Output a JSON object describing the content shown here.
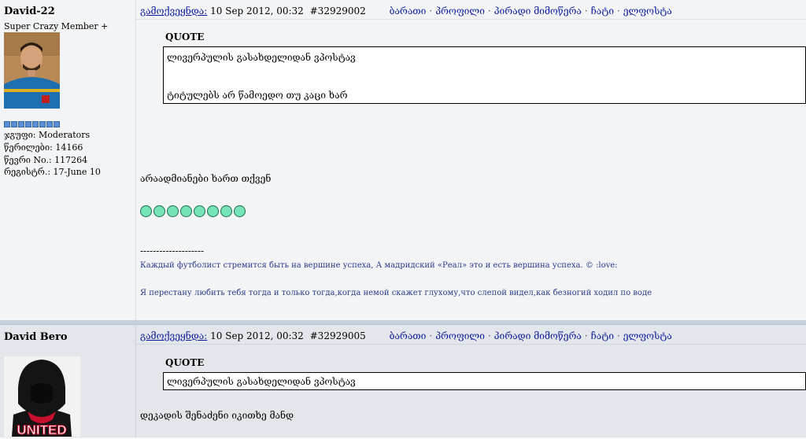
{
  "posts": [
    {
      "username": "David-22",
      "rank": "Super Crazy Member +",
      "group": "ჯგუფი: Moderators",
      "posts_count": "წერილები: 14166",
      "member_no": "წევრი No.: 117264",
      "registered": "რეგისტრ.: 17-June 10",
      "pips": 8,
      "posted_label": "გამოქვეყნდა:",
      "date": "10 Sep 2012, 00:32",
      "post_id": "#32929002",
      "actions": [
        "ბარათი",
        "პროფილი",
        "პირადი მიმოწერა",
        "ჩატი",
        "ელფოსტა"
      ],
      "quote_label": "QUOTE",
      "quote_lines": [
        "ლივერპულის გასახდელიდან ვპოსტავ",
        "ტიტულებს არ წამოედო თუ კაცი ხარ"
      ],
      "body": "არაადმიანები ხართ თქვენ",
      "dots": 8,
      "sig_dashes": "--------------------",
      "sig_lines": [
        "Каждый футболист стремится быть на вершине успеха, А мадридский «Реал» это и есть вершина успеха. © :love:",
        "Я перестану любить тебя тогда и только тогда,когда немой скажет глухому,что слепой видел,как безногий ходил по воде"
      ]
    },
    {
      "username": "David Bero",
      "posted_label": "გამოქვეყნდა:",
      "date": "10 Sep 2012, 00:32",
      "post_id": "#32929005",
      "actions": [
        "ბარათი",
        "პროფილი",
        "პირადი მიმოწერა",
        "ჩატი",
        "ელფოსტა"
      ],
      "quote_label": "QUOTE",
      "quote_lines": [
        "ლივერპულის გასახდელიდან ვპოსტავ"
      ],
      "body": "დეკადის შენაძენი იკითხე მანდ",
      "avatar_text": "UNITED"
    }
  ]
}
